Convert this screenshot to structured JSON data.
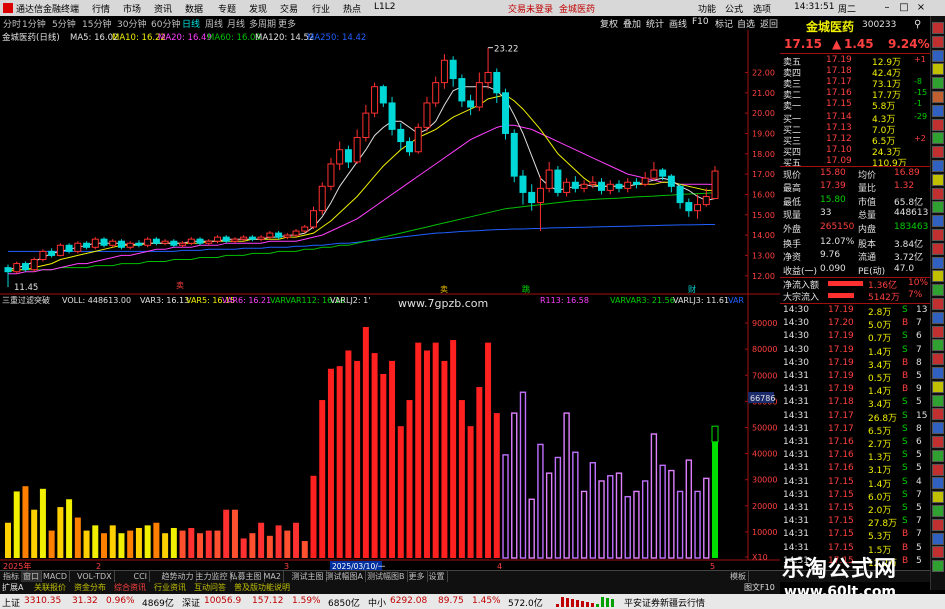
{
  "titlebar": {
    "app_name": "通达信金融终端",
    "menus": [
      "行情",
      "市场",
      "资讯",
      "数据",
      "专题",
      "发现",
      "交易",
      "行业",
      "热点"
    ],
    "code": "L1L2",
    "login": "交易未登录",
    "stock": "金城医药",
    "right_menus": [
      "功能",
      "公式",
      "选项"
    ],
    "time": "14:31:51",
    "day": "周二"
  },
  "periods": [
    "分时",
    "1分钟",
    "5分钟",
    "15分钟",
    "30分钟",
    "60分钟",
    "日线",
    "周线",
    "月线",
    "多周期",
    "更多"
  ],
  "active_period": "日线",
  "right_tools": [
    "复权",
    "叠加",
    "统计",
    "画线",
    "F10",
    "标记",
    "自选",
    "返回"
  ],
  "ma_bar": {
    "name": "金城医药(日线)",
    "ma5": "MA5: 16.02",
    "ma10": "MA10: 16.22",
    "ma20": "MA20: 16.49",
    "ma60": "MA60: 16.09",
    "ma120": "MA120: 14.52",
    "ma250": "MA250: 14.42"
  },
  "indicator_bar": {
    "name": "三重过滤突破",
    "voll": "VOLL: 448613.00",
    "var3": "VAR3: 16.13",
    "var5": "VAR5: 16.15",
    "var6": "VAR6: 16.21",
    "varvar112": "VARVAR112: 16.16",
    "varlj2": "VARLJ2: 1'",
    "var113": "R113: 16.58",
    "varvar3": "VARVAR3: 21.56",
    "varlj3": "VARLJ3: 11.61",
    "tail": "VAR"
  },
  "price_annotations": {
    "high": "23.22",
    "low": "11.45"
  },
  "price_axis": [
    "22.00",
    "21.00",
    "20.00",
    "19.00",
    "18.00",
    "17.00",
    "16.00",
    "15.00",
    "14.00",
    "13.00",
    "12.00"
  ],
  "vol_axis": [
    "90000",
    "80000",
    "70000",
    "60000",
    "50000",
    "40000",
    "30000",
    "20000",
    "10000",
    "X10"
  ],
  "vol_cursor": "66786",
  "time_axis": [
    "2025年",
    "2",
    "3",
    "2025/03/10/一",
    "4",
    "5"
  ],
  "markers": {
    "sell": "卖",
    "jump": "跳",
    "cai": "财",
    "s_mark": "S"
  },
  "colors": {
    "up": "#ff3030",
    "down": "#00d8d8",
    "ma5": "#e0e0e0",
    "ma10": "#f0f000",
    "ma20": "#ff40ff",
    "ma60": "#00c000",
    "ma120": "#2060ff",
    "ma250": "#a0a0a0"
  },
  "stock_head": {
    "name": "金城医药",
    "code": "300233"
  },
  "quote": {
    "price": "17.15",
    "change": "1.45",
    "pct": "9.24%",
    "asks": [
      {
        "label": "卖五",
        "price": "17.19",
        "vol": "12.9万"
      },
      {
        "label": "卖四",
        "price": "17.18",
        "vol": "42.4万"
      },
      {
        "label": "卖三",
        "price": "17.17",
        "vol": "73.1万"
      },
      {
        "label": "卖二",
        "price": "17.16",
        "vol": "17.7万"
      },
      {
        "label": "卖一",
        "price": "17.15",
        "vol": "5.8万"
      }
    ],
    "bids": [
      {
        "label": "买一",
        "price": "17.14",
        "vol": "4.3万"
      },
      {
        "label": "买二",
        "price": "17.13",
        "vol": "7.0万"
      },
      {
        "label": "买三",
        "price": "17.12",
        "vol": "6.5万"
      },
      {
        "label": "买四",
        "price": "17.10",
        "vol": "24.3万"
      },
      {
        "label": "买五",
        "price": "17.09",
        "vol": "110.9万"
      }
    ],
    "ask_side": [
      "+1",
      "-8",
      "-1",
      "-15"
    ],
    "bid_side": [
      "-29",
      "+2"
    ],
    "stats": [
      {
        "l1": "现价",
        "v1": "15.80",
        "l2": "均价",
        "v2": "16.89"
      },
      {
        "l1": "最高",
        "v1": "17.39",
        "l2": "量比",
        "v2": "1.32"
      },
      {
        "l1": "最低",
        "v1": "15.80",
        "l2": "市值",
        "v2": "65.8亿"
      },
      {
        "l1": "现量",
        "v1": "33",
        "l2": "总量",
        "v2": "448613"
      },
      {
        "l1": "外盘",
        "v1": "265150",
        "l2": "内盘",
        "v2": "183463"
      },
      {
        "l1": "换手",
        "v1": "12.07%",
        "l2": "股本",
        "v2": "3.84亿"
      },
      {
        "l1": "净资",
        "v1": "9.76",
        "l2": "流通",
        "v2": "3.72亿"
      },
      {
        "l1": "收益(一)",
        "v1": "0.090",
        "l2": "PE(动)",
        "v2": "47.0"
      }
    ],
    "net_flow": {
      "label": "净流入额",
      "value": "1.36亿",
      "pct": "10%"
    },
    "big_flow": {
      "label": "大宗流入",
      "value": "5142万",
      "pct": "7%"
    },
    "ticks": [
      {
        "t": "14:30",
        "p": "17.19",
        "v": "2.8万",
        "s": "S",
        "n": "13"
      },
      {
        "t": "14:30",
        "p": "17.20",
        "v": "5.0万",
        "s": "B",
        "n": "7"
      },
      {
        "t": "14:30",
        "p": "17.19",
        "v": "0.7万",
        "s": "S",
        "n": "6"
      },
      {
        "t": "14:30",
        "p": "17.19",
        "v": "1.4万",
        "s": "S",
        "n": "7"
      },
      {
        "t": "14:30",
        "p": "17.19",
        "v": "3.4万",
        "s": "B",
        "n": "8"
      },
      {
        "t": "14:31",
        "p": "17.19",
        "v": "0.5万",
        "s": "B",
        "n": "5"
      },
      {
        "t": "14:31",
        "p": "17.19",
        "v": "1.4万",
        "s": "B",
        "n": "9"
      },
      {
        "t": "14:31",
        "p": "17.18",
        "v": "3.4万",
        "s": "S",
        "n": "5"
      },
      {
        "t": "14:31",
        "p": "17.17",
        "v": "26.8万",
        "s": "S",
        "n": "15"
      },
      {
        "t": "14:31",
        "p": "17.17",
        "v": "6.5万",
        "s": "S",
        "n": "8"
      },
      {
        "t": "14:31",
        "p": "17.16",
        "v": "2.7万",
        "s": "S",
        "n": "6"
      },
      {
        "t": "14:31",
        "p": "17.16",
        "v": "1.3万",
        "s": "S",
        "n": "5"
      },
      {
        "t": "14:31",
        "p": "17.16",
        "v": "3.1万",
        "s": "S",
        "n": "5"
      },
      {
        "t": "14:31",
        "p": "17.15",
        "v": "1.4万",
        "s": "S",
        "n": "4"
      },
      {
        "t": "14:31",
        "p": "17.15",
        "v": "6.0万",
        "s": "S",
        "n": "7"
      },
      {
        "t": "14:31",
        "p": "17.15",
        "v": "2.0万",
        "s": "S",
        "n": "5"
      },
      {
        "t": "14:31",
        "p": "17.15",
        "v": "27.8万",
        "s": "S",
        "n": "7"
      },
      {
        "t": "14:31",
        "p": "17.15",
        "v": "5.3万",
        "s": "B",
        "n": "7"
      },
      {
        "t": "14:31",
        "p": "17.15",
        "v": "1.5万",
        "s": "B",
        "n": "5"
      },
      {
        "t": "14:31",
        "p": "17.15",
        "v": "12.2万",
        "s": "B",
        "n": "5"
      }
    ]
  },
  "bottom_tabs": [
    "指标",
    "窗口",
    "MACD",
    "VOL-TDX",
    "CCI",
    "趋势动力",
    "主力监控",
    "私募主图",
    "MA2",
    "测试主图",
    "测试幅图A",
    "测试幅图B",
    "更多",
    "设置"
  ],
  "bottom_tabs_right": [
    "模板"
  ],
  "link_bar": [
    "扩展A",
    "关联报价",
    "资金分布",
    "综合资讯",
    "行业资讯",
    "互动问答",
    "普及版功能说明"
  ],
  "link_bar_right": "图文F10",
  "status_bar": {
    "items": [
      {
        "name": "上证",
        "v": "3310.35",
        "c": "31.32",
        "p": "0.96%",
        "a": "4869亿"
      },
      {
        "name": "深证",
        "v": "10056.9",
        "c": "157.12",
        "p": "1.59%",
        "a": "6850亿"
      },
      {
        "name": "中小",
        "v": "6292.08",
        "c": "89.75",
        "p": "1.45%",
        "a": "572.0亿"
      }
    ],
    "broker": "平安证券新疆云行情"
  },
  "watermarks": {
    "top_mid": "www.7gpzb.com",
    "br_title": "乐淘公式网",
    "br_url": "www.60lt.com"
  },
  "chart_data": {
    "type": "candlestick+bar",
    "candles": [
      [
        12.4,
        12.2,
        12.55,
        11.45
      ],
      [
        12.2,
        12.6,
        12.7,
        12.1
      ],
      [
        12.6,
        12.3,
        12.7,
        12.2
      ],
      [
        12.3,
        12.8,
        12.9,
        12.2
      ],
      [
        12.8,
        13.2,
        13.3,
        12.7
      ],
      [
        13.2,
        13.0,
        13.35,
        12.9
      ],
      [
        13.0,
        13.5,
        13.6,
        12.95
      ],
      [
        13.5,
        13.2,
        13.6,
        13.1
      ],
      [
        13.2,
        13.6,
        13.7,
        13.1
      ],
      [
        13.6,
        13.4,
        13.7,
        13.3
      ],
      [
        13.4,
        13.8,
        13.9,
        13.3
      ],
      [
        13.8,
        13.5,
        13.9,
        13.4
      ],
      [
        13.5,
        13.7,
        13.8,
        13.4
      ],
      [
        13.7,
        13.4,
        13.8,
        13.3
      ],
      [
        13.4,
        13.6,
        13.7,
        13.3
      ],
      [
        13.6,
        13.5,
        13.75,
        13.4
      ],
      [
        13.5,
        13.8,
        13.9,
        13.4
      ],
      [
        13.8,
        13.6,
        13.9,
        13.5
      ],
      [
        13.6,
        13.7,
        13.8,
        13.5
      ],
      [
        13.7,
        13.5,
        13.8,
        13.4
      ],
      [
        13.5,
        13.6,
        13.7,
        13.4
      ],
      [
        13.6,
        13.8,
        13.9,
        13.5
      ],
      [
        13.8,
        13.6,
        13.9,
        13.5
      ],
      [
        13.6,
        13.7,
        13.8,
        13.5
      ],
      [
        13.7,
        13.9,
        14.0,
        13.6
      ],
      [
        13.9,
        13.7,
        14.0,
        13.6
      ],
      [
        13.7,
        13.8,
        13.9,
        13.6
      ],
      [
        13.8,
        13.9,
        14.0,
        13.7
      ],
      [
        13.9,
        13.8,
        14.0,
        13.7
      ],
      [
        13.8,
        13.9,
        14.0,
        13.7
      ],
      [
        13.9,
        14.1,
        14.2,
        13.8
      ],
      [
        14.1,
        13.9,
        14.2,
        13.8
      ],
      [
        13.9,
        14.0,
        14.1,
        13.8
      ],
      [
        14.0,
        14.2,
        14.3,
        13.9
      ],
      [
        14.2,
        14.4,
        14.5,
        14.1
      ],
      [
        14.4,
        15.2,
        15.4,
        14.3
      ],
      [
        15.2,
        16.4,
        16.6,
        15.0
      ],
      [
        16.4,
        17.5,
        17.8,
        16.2
      ],
      [
        17.5,
        18.2,
        18.6,
        17.2
      ],
      [
        18.2,
        17.6,
        18.4,
        17.3
      ],
      [
        17.6,
        18.8,
        19.2,
        17.5
      ],
      [
        18.8,
        20.0,
        20.4,
        18.6
      ],
      [
        20.0,
        21.3,
        21.5,
        19.8
      ],
      [
        21.3,
        20.5,
        21.4,
        20.3
      ],
      [
        20.5,
        19.2,
        20.8,
        18.9
      ],
      [
        19.2,
        18.6,
        19.5,
        18.2
      ],
      [
        18.6,
        18.1,
        18.8,
        17.9
      ],
      [
        18.1,
        19.3,
        19.5,
        18.0
      ],
      [
        19.3,
        20.5,
        20.8,
        19.1
      ],
      [
        20.5,
        21.5,
        21.8,
        20.3
      ],
      [
        21.5,
        22.6,
        22.9,
        21.2
      ],
      [
        22.6,
        21.7,
        22.8,
        21.3
      ],
      [
        21.7,
        20.6,
        21.9,
        20.3
      ],
      [
        20.6,
        20.3,
        20.9,
        19.9
      ],
      [
        20.3,
        21.5,
        22.0,
        20.1
      ],
      [
        21.5,
        22.0,
        23.22,
        21.2
      ],
      [
        22.0,
        21.0,
        22.2,
        20.5
      ],
      [
        21.0,
        19.0,
        21.2,
        18.7
      ],
      [
        19.0,
        16.9,
        19.2,
        16.6
      ],
      [
        16.9,
        16.1,
        17.2,
        15.5
      ],
      [
        16.1,
        15.6,
        16.5,
        15.2
      ],
      [
        15.6,
        16.3,
        16.9,
        14.2
      ],
      [
        16.3,
        17.2,
        17.6,
        16.1
      ],
      [
        17.2,
        16.1,
        17.4,
        15.9
      ],
      [
        16.1,
        16.6,
        16.8,
        15.9
      ],
      [
        16.6,
        16.3,
        16.9,
        16.1
      ],
      [
        16.3,
        16.5,
        16.7,
        16.1
      ],
      [
        16.5,
        16.6,
        16.9,
        16.3
      ],
      [
        16.6,
        16.2,
        16.8,
        16.0
      ],
      [
        16.2,
        16.5,
        16.7,
        16.0
      ],
      [
        16.5,
        16.3,
        16.7,
        16.1
      ],
      [
        16.3,
        16.6,
        16.8,
        16.1
      ],
      [
        16.6,
        16.5,
        16.8,
        16.3
      ],
      [
        16.5,
        16.8,
        17.1,
        16.4
      ],
      [
        16.8,
        17.2,
        17.6,
        16.7
      ],
      [
        17.2,
        16.9,
        17.3,
        16.7
      ],
      [
        16.9,
        16.4,
        17.0,
        16.1
      ],
      [
        16.4,
        15.6,
        16.5,
        15.3
      ],
      [
        15.6,
        15.2,
        15.8,
        14.9
      ],
      [
        15.2,
        15.5,
        16.0,
        14.8
      ],
      [
        15.5,
        15.9,
        16.3,
        15.4
      ],
      [
        15.8,
        17.15,
        17.39,
        15.8
      ]
    ],
    "ma5": [
      12.3,
      12.4,
      12.5,
      12.7,
      12.9,
      13.1,
      13.2,
      13.3,
      13.4,
      13.5,
      13.6,
      13.6,
      13.6,
      13.6,
      13.5,
      13.6,
      13.6,
      13.6,
      13.6,
      13.6,
      13.6,
      13.7,
      13.7,
      13.7,
      13.7,
      13.8,
      13.8,
      13.8,
      13.8,
      13.8,
      13.9,
      13.9,
      14.0,
      14.0,
      14.1,
      14.4,
      14.9,
      15.6,
      16.4,
      17.0,
      17.6,
      18.2,
      18.9,
      19.3,
      19.6,
      19.6,
      19.3,
      19.0,
      19.2,
      19.6,
      20.4,
      21.1,
      21.3,
      21.3,
      21.3,
      21.3,
      21.1,
      20.7,
      19.9,
      19.0,
      17.9,
      16.8,
      16.4,
      16.2,
      16.3,
      16.4,
      16.5,
      16.4,
      16.4,
      16.4,
      16.4,
      16.4,
      16.5,
      16.6,
      16.7,
      16.8,
      16.7,
      16.4,
      16.2,
      15.9,
      15.7,
      15.8
    ],
    "ma10": [
      12.2,
      12.3,
      12.3,
      12.4,
      12.5,
      12.6,
      12.8,
      12.9,
      13.0,
      13.1,
      13.2,
      13.3,
      13.4,
      13.5,
      13.5,
      13.5,
      13.6,
      13.6,
      13.6,
      13.6,
      13.6,
      13.6,
      13.6,
      13.7,
      13.7,
      13.7,
      13.7,
      13.7,
      13.8,
      13.8,
      13.8,
      13.8,
      13.9,
      13.9,
      14.0,
      14.1,
      14.4,
      14.7,
      15.1,
      15.5,
      15.9,
      16.4,
      16.9,
      17.4,
      17.8,
      18.2,
      18.5,
      18.8,
      19.0,
      19.2,
      19.5,
      19.8,
      20.0,
      20.2,
      20.4,
      20.7,
      20.8,
      20.9,
      20.6,
      20.2,
      19.7,
      19.2,
      18.6,
      18.0,
      17.6,
      17.2,
      16.8,
      16.5,
      16.4,
      16.4,
      16.4,
      16.4,
      16.5,
      16.5,
      16.5,
      16.6,
      16.6,
      16.5,
      16.4,
      16.3,
      16.2,
      16.2
    ],
    "ma20": [
      12.1,
      12.1,
      12.2,
      12.2,
      12.3,
      12.3,
      12.4,
      12.5,
      12.6,
      12.6,
      12.7,
      12.8,
      12.9,
      13.0,
      13.0,
      13.1,
      13.2,
      13.3,
      13.3,
      13.4,
      13.4,
      13.4,
      13.5,
      13.5,
      13.5,
      13.6,
      13.6,
      13.6,
      13.6,
      13.6,
      13.7,
      13.7,
      13.7,
      13.7,
      13.8,
      13.9,
      14.0,
      14.2,
      14.4,
      14.6,
      14.8,
      15.1,
      15.4,
      15.7,
      16.0,
      16.3,
      16.6,
      16.9,
      17.2,
      17.5,
      17.8,
      18.1,
      18.4,
      18.7,
      18.9,
      19.1,
      19.3,
      19.4,
      19.4,
      19.3,
      19.2,
      19.0,
      18.8,
      18.6,
      18.4,
      18.2,
      18.0,
      17.8,
      17.6,
      17.4,
      17.2,
      17.0,
      16.9,
      16.8,
      16.7,
      16.6,
      16.6,
      16.5,
      16.5,
      16.5,
      16.5,
      16.49
    ],
    "ma60": [
      12.3,
      12.3,
      12.3,
      12.3,
      12.3,
      12.3,
      12.4,
      12.4,
      12.4,
      12.4,
      12.5,
      12.5,
      12.5,
      12.6,
      12.6,
      12.6,
      12.7,
      12.7,
      12.7,
      12.8,
      12.8,
      12.8,
      12.9,
      12.9,
      12.9,
      13.0,
      13.0,
      13.0,
      13.1,
      13.1,
      13.1,
      13.2,
      13.2,
      13.2,
      13.3,
      13.3,
      13.4,
      13.4,
      13.5,
      13.5,
      13.6,
      13.7,
      13.8,
      13.9,
      14.0,
      14.1,
      14.2,
      14.3,
      14.4,
      14.5,
      14.6,
      14.7,
      14.8,
      14.9,
      15.0,
      15.1,
      15.2,
      15.3,
      15.35,
      15.4,
      15.45,
      15.5,
      15.55,
      15.6,
      15.65,
      15.7,
      15.72,
      15.75,
      15.78,
      15.8,
      15.82,
      15.85,
      15.88,
      15.9,
      15.92,
      15.95,
      15.97,
      16.0,
      16.02,
      16.04,
      16.06,
      16.09
    ],
    "ma120": [
      13.2,
      13.2,
      13.2,
      13.2,
      13.2,
      13.2,
      13.2,
      13.2,
      13.2,
      13.2,
      13.2,
      13.2,
      13.2,
      13.2,
      13.2,
      13.2,
      13.2,
      13.2,
      13.2,
      13.2,
      13.25,
      13.25,
      13.25,
      13.3,
      13.3,
      13.3,
      13.3,
      13.35,
      13.35,
      13.35,
      13.4,
      13.4,
      13.4,
      13.45,
      13.45,
      13.5,
      13.5,
      13.55,
      13.6,
      13.6,
      13.65,
      13.7,
      13.75,
      13.8,
      13.85,
      13.9,
      13.95,
      14.0,
      14.05,
      14.1,
      14.12,
      14.15,
      14.18,
      14.2,
      14.22,
      14.25,
      14.27,
      14.28,
      14.3,
      14.3,
      14.32,
      14.33,
      14.35,
      14.36,
      14.37,
      14.38,
      14.39,
      14.4,
      14.41,
      14.42,
      14.43,
      14.44,
      14.45,
      14.46,
      14.47,
      14.48,
      14.49,
      14.5,
      14.5,
      14.51,
      14.52,
      14.52
    ],
    "volume": [
      1.35,
      2.55,
      2.75,
      1.85,
      2.65,
      1.05,
      1.95,
      2.25,
      1.55,
      1.05,
      1.25,
      0.95,
      1.25,
      0.95,
      1.05,
      1.15,
      1.25,
      1.35,
      0.95,
      1.15,
      1.05,
      1.15,
      0.95,
      1.05,
      1.05,
      1.85,
      1.85,
      0.75,
      0.95,
      1.35,
      0.85,
      1.25,
      1.05,
      1.35,
      0.65,
      3.15,
      6.05,
      7.25,
      7.35,
      7.95,
      7.55,
      8.85,
      7.85,
      7.05,
      7.55,
      5.05,
      6.05,
      8.25,
      7.95,
      8.25,
      7.55,
      8.35,
      6.05,
      5.05,
      6.55,
      8.25,
      5.55,
      3.95,
      5.55,
      6.35,
      2.25,
      4.35,
      3.25,
      3.85,
      5.55,
      4.05,
      2.55,
      3.65,
      2.95,
      3.15,
      3.25,
      2.35,
      2.55,
      2.95,
      4.75,
      3.55,
      3.35,
      2.55,
      3.75,
      2.55,
      3.05,
      4.45
    ],
    "ylim_price": [
      11.45,
      23.22
    ],
    "ylim_volume": [
      0,
      9.5
    ]
  }
}
